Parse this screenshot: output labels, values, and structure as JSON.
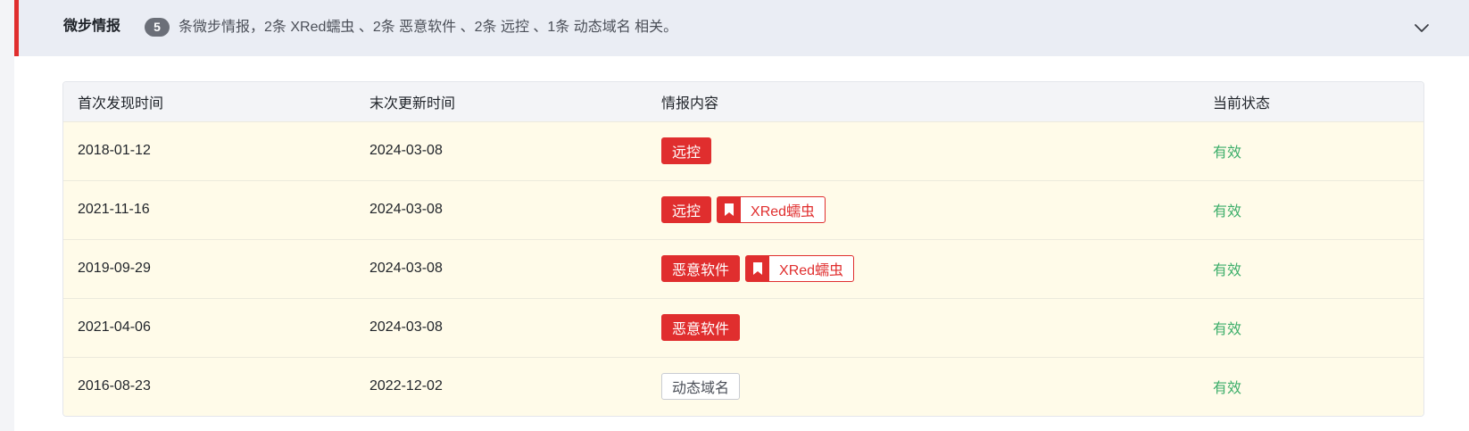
{
  "header": {
    "title": "微步情报",
    "count": "5",
    "summary": "条微步情报，2条 XRed蠕虫 、2条 恶意软件 、2条 远控 、1条 动态域名 相关。",
    "toggle_icon": "chevron-down-icon"
  },
  "colors": {
    "accent_red": "#e02e2e",
    "status_green": "#3dae6a",
    "row_background": "#fffbe9"
  },
  "table": {
    "columns": [
      "首次发现时间",
      "末次更新时间",
      "情报内容",
      "当前状态"
    ],
    "rows": [
      {
        "first_seen": "2018-01-12",
        "last_updated": "2024-03-08",
        "tags": [
          {
            "label": "远控",
            "kind": "solid"
          }
        ],
        "status": "有效"
      },
      {
        "first_seen": "2021-11-16",
        "last_updated": "2024-03-08",
        "tags": [
          {
            "label": "远控",
            "kind": "solid"
          },
          {
            "label": "XRed蠕虫",
            "kind": "family",
            "icon": "bookmark-icon"
          }
        ],
        "status": "有效"
      },
      {
        "first_seen": "2019-09-29",
        "last_updated": "2024-03-08",
        "tags": [
          {
            "label": "恶意软件",
            "kind": "solid"
          },
          {
            "label": "XRed蠕虫",
            "kind": "family",
            "icon": "bookmark-icon"
          }
        ],
        "status": "有效"
      },
      {
        "first_seen": "2021-04-06",
        "last_updated": "2024-03-08",
        "tags": [
          {
            "label": "恶意软件",
            "kind": "solid"
          }
        ],
        "status": "有效"
      },
      {
        "first_seen": "2016-08-23",
        "last_updated": "2022-12-02",
        "tags": [
          {
            "label": "动态域名",
            "kind": "outline"
          }
        ],
        "status": "有效"
      }
    ]
  }
}
